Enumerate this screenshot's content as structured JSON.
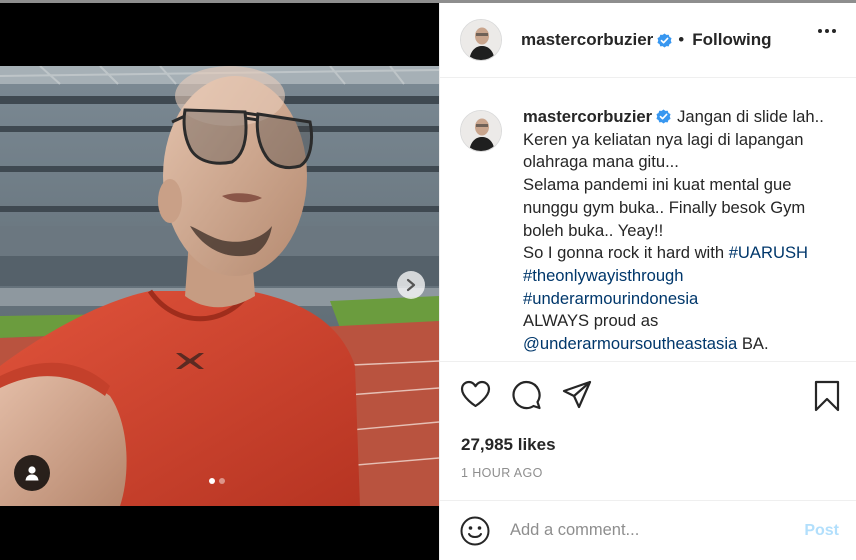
{
  "post": {
    "username": "mastercorbuzier",
    "separator": "•",
    "follow_status": "Following",
    "caption_lines": [
      "Jangan di slide lah..",
      "Keren ya keliatan nya lagi di lapangan",
      "olahraga mana gitu...",
      "Selama pandemi ini kuat mental gue",
      "nunggu gym buka.. Finally besok Gym",
      "boleh buka.. Yeay!!",
      "So I gonna rock it hard with "
    ],
    "hashtags": [
      "#UARUSH",
      "#theonlywayisthrough",
      "#underarmourindonesia"
    ],
    "caption_tail": "ALWAYS proud as",
    "mention": "@underarmoursoutheastasia",
    "mention_suffix": " BA.",
    "likes": "27,985 likes",
    "time_ago": "1 HOUR AGO"
  },
  "comment": {
    "placeholder": "Add a comment...",
    "post_label": "Post"
  },
  "carousel": {
    "total_slides": 2,
    "active_slide": 1
  },
  "colors": {
    "verified": "#3897f0",
    "link": "#00376b",
    "post_disabled": "#b2dffc",
    "shirt": "#d9452f"
  },
  "icons": [
    "verified-badge-icon",
    "more-options-icon",
    "next-arrow-icon",
    "tag-user-icon",
    "heart-icon",
    "comment-icon",
    "share-icon",
    "bookmark-icon",
    "emoji-icon"
  ]
}
